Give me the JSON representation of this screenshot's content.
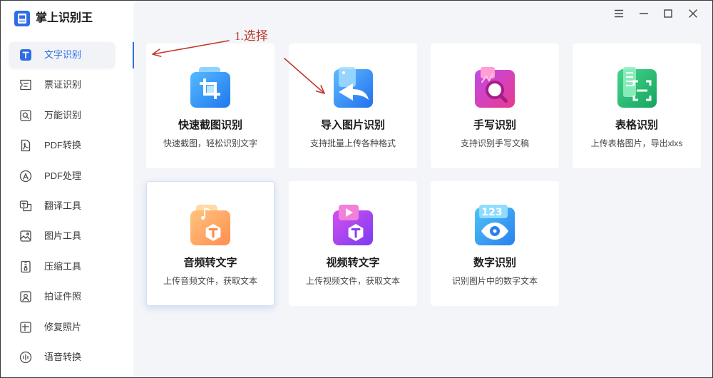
{
  "app": {
    "name": "掌上识别王",
    "logo_icon": "app-logo-icon",
    "accent_color": "#2f6de6"
  },
  "window_controls": {
    "menu_icon": "menu-icon",
    "minimize_icon": "minimize-icon",
    "maximize_icon": "maximize-icon",
    "close_icon": "close-icon"
  },
  "sidebar": {
    "items": [
      {
        "label": "文字识别",
        "icon": "text-recognition-icon",
        "selected": true
      },
      {
        "label": "票证识别",
        "icon": "ticket-icon",
        "selected": false
      },
      {
        "label": "万能识别",
        "icon": "universal-scan-icon",
        "selected": false
      },
      {
        "label": "PDF转换",
        "icon": "pdf-convert-icon",
        "selected": false
      },
      {
        "label": "PDF处理",
        "icon": "pdf-process-icon",
        "selected": false
      },
      {
        "label": "翻译工具",
        "icon": "translate-icon",
        "selected": false
      },
      {
        "label": "图片工具",
        "icon": "image-tools-icon",
        "selected": false
      },
      {
        "label": "压缩工具",
        "icon": "compress-icon",
        "selected": false
      },
      {
        "label": "拍证件照",
        "icon": "id-photo-icon",
        "selected": false
      },
      {
        "label": "修复照片",
        "icon": "photo-repair-icon",
        "selected": false
      },
      {
        "label": "语音转换",
        "icon": "voice-convert-icon",
        "selected": false
      }
    ]
  },
  "annotation": {
    "label": "1.选择",
    "color": "#c0392b"
  },
  "cards": [
    {
      "title": "快速截图识别",
      "description": "快速截图，轻松识别文字",
      "icon": "screenshot-crop-icon",
      "colors": [
        "#55baff",
        "#1f78ef"
      ],
      "hovered": false
    },
    {
      "title": "导入图片识别",
      "description": "支持批量上传各种格式",
      "icon": "import-image-icon",
      "colors": [
        "#5cbcff",
        "#2370ee"
      ],
      "hovered": false
    },
    {
      "title": "手写识别",
      "description": "支持识别手写文稿",
      "icon": "handwriting-search-icon",
      "colors": [
        "#c24ae8",
        "#e8398e"
      ],
      "hovered": false
    },
    {
      "title": "表格识别",
      "description": "上传表格图片，导出xlxs",
      "icon": "table-scan-icon",
      "colors": [
        "#43d58c",
        "#17a45f"
      ],
      "hovered": false
    },
    {
      "title": "音频转文字",
      "description": "上传音频文件，获取文本",
      "icon": "audio-to-text-icon",
      "colors": [
        "#ffc47f",
        "#ff8e4f"
      ],
      "hovered": true
    },
    {
      "title": "视频转文字",
      "description": "上传视频文件，获取文本",
      "icon": "video-to-text-icon",
      "colors": [
        "#d450ee",
        "#7b3cf0"
      ],
      "hovered": false
    },
    {
      "title": "数字识别",
      "description": "识别图片中的数字文本",
      "icon": "digit-recognition-icon",
      "colors": [
        "#4ec3f7",
        "#2a80ee"
      ],
      "icon_label": "123",
      "hovered": false
    }
  ]
}
